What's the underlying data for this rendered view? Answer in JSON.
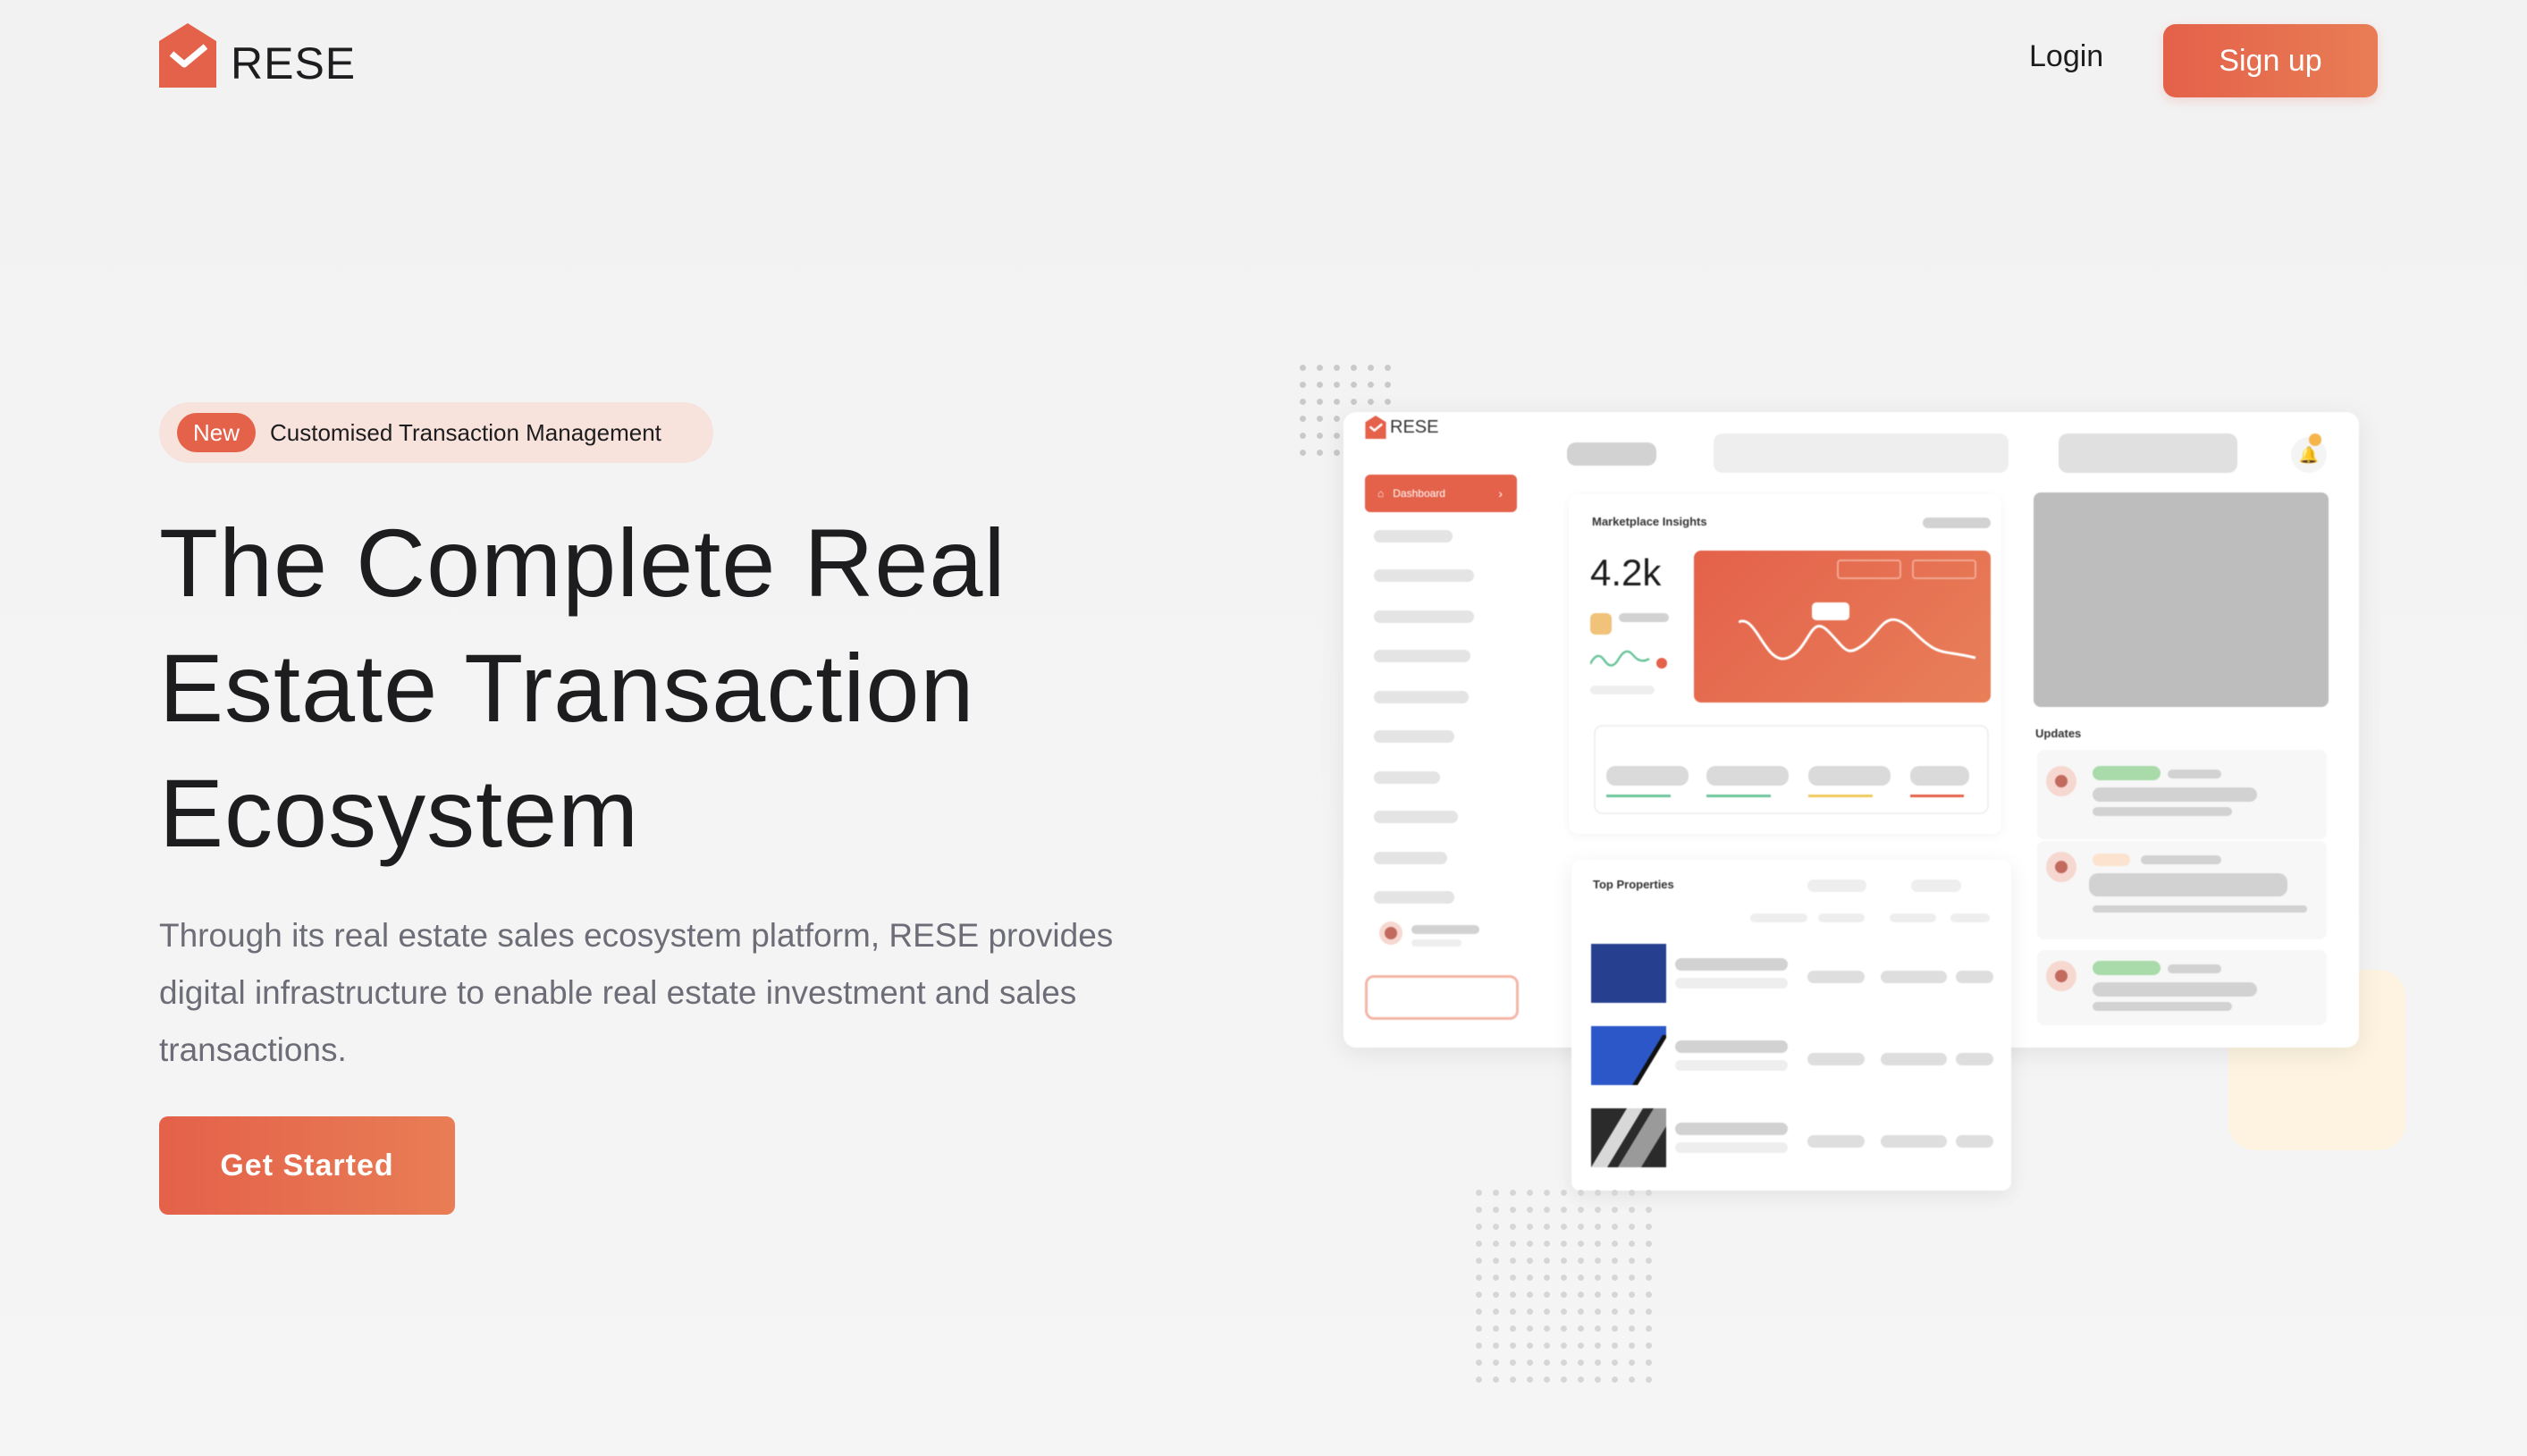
{
  "nav": {
    "brand": "RESE",
    "login_label": "Login",
    "signup_label": "Sign up"
  },
  "hero": {
    "badge_tag": "New",
    "badge_text": "Customised Transaction Management",
    "title_lines": [
      "The Complete Real",
      "Estate Transaction",
      "Ecosystem"
    ],
    "subtitle": "Through its real estate sales ecosystem platform, RESE provides digital infrastructure to enable real estate investment and sales transactions.",
    "cta_label": "Get Started"
  },
  "dashboard": {
    "brand": "RESE",
    "sidebar_active": "Dashboard",
    "insights_title": "Marketplace Insights",
    "insights_value": "4.2k",
    "updates_title": "Updates",
    "top_properties_title": "Top Properties"
  },
  "colors": {
    "accent": "#e4614a",
    "accent_light": "#e87d55",
    "badge_bg": "#f8e2dc",
    "cream": "#fdf3e0",
    "text_muted": "#6d6d78"
  }
}
